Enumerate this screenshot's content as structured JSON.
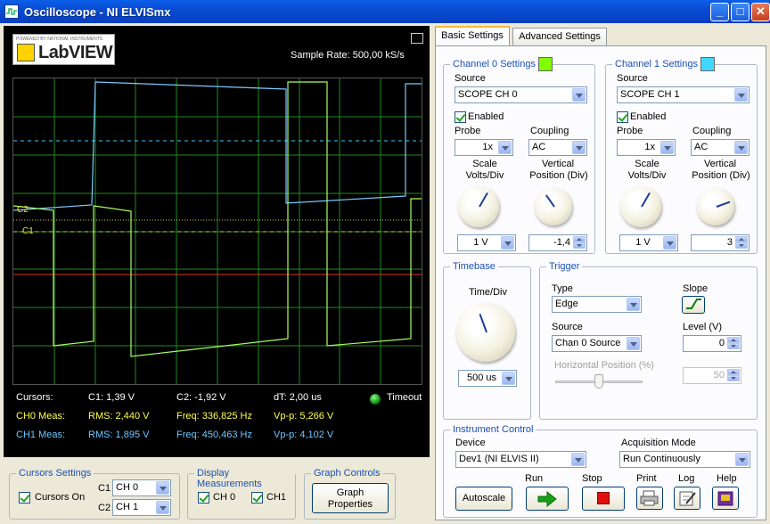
{
  "window": {
    "title": "Oscilloscope - NI ELVISmx"
  },
  "logo": {
    "brand_small": "POWERED BY NATIONAL INSTRUMENTS",
    "text": "LabVIEW"
  },
  "display": {
    "sample_rate": "Sample Rate:  500,00 kS/s",
    "ch_marker_c2": "C2",
    "ch_marker_c1": "C1"
  },
  "readouts": {
    "cursors_label": "Cursors:",
    "c1": "C1:  1,39 V",
    "c2": "C2:  -1,92 V",
    "dt": "dT:  2,00 us",
    "timeout": "Timeout",
    "ch0_label": "CH0 Meas:",
    "ch0_rms": "RMS:  2,440 V",
    "ch0_freq": "Freq:  336,825 Hz",
    "ch0_vpp": "Vp-p:  5,266 V",
    "ch1_label": "CH1 Meas:",
    "ch1_rms": "RMS:  1,895 V",
    "ch1_freq": "Freq:  450,463 Hz",
    "ch1_vpp": "Vp-p:  4,102 V"
  },
  "cursors_settings": {
    "title": "Cursors Settings",
    "cursors_on": "Cursors On",
    "c1_label": "C1",
    "c1_value": "CH 0",
    "c2_label": "C2",
    "c2_value": "CH 1"
  },
  "display_measurements": {
    "title": "Display Measurements",
    "ch0": "CH 0",
    "ch1": "CH1"
  },
  "graph_controls": {
    "title": "Graph Controls",
    "button_line1": "Graph",
    "button_line2": "Properties"
  },
  "tabs": {
    "basic": "Basic Settings",
    "advanced": "Advanced Settings"
  },
  "channel0": {
    "title": "Channel 0 Settings",
    "color": "#80ff00",
    "source_label": "Source",
    "source": "SCOPE CH 0",
    "enabled": "Enabled",
    "probe_label": "Probe",
    "probe": "1x",
    "coupling_label": "Coupling",
    "coupling": "AC",
    "scale_label1": "Scale",
    "scale_label2": "Volts/Div",
    "vpos_label1": "Vertical",
    "vpos_label2": "Position (Div)",
    "scale": "1 V",
    "vpos": "-1,4"
  },
  "channel1": {
    "title": "Channel 1 Settings",
    "color": "#40d8ff",
    "source_label": "Source",
    "source": "SCOPE CH 1",
    "enabled": "Enabled",
    "probe_label": "Probe",
    "probe": "1x",
    "coupling_label": "Coupling",
    "coupling": "AC",
    "scale_label1": "Scale",
    "scale_label2": "Volts/Div",
    "vpos_label1": "Vertical",
    "vpos_label2": "Position (Div)",
    "scale": "1 V",
    "vpos": "3"
  },
  "timebase": {
    "title": "Timebase",
    "label": "Time/Div",
    "value": "500 us"
  },
  "trigger": {
    "title": "Trigger",
    "type_label": "Type",
    "type": "Edge",
    "slope_label": "Slope",
    "source_label": "Source",
    "source": "Chan 0 Source",
    "level_label": "Level (V)",
    "level": "0",
    "hpos_label": "Horizontal Position (%)",
    "hpos": "50"
  },
  "instrument": {
    "title": "Instrument Control",
    "device_label": "Device",
    "device": "Dev1 (NI ELVIS II)",
    "acq_label": "Acquisition Mode",
    "acq": "Run Continuously",
    "autoscale": "Autoscale",
    "run": "Run",
    "stop": "Stop",
    "print": "Print",
    "log": "Log",
    "help": "Help"
  }
}
